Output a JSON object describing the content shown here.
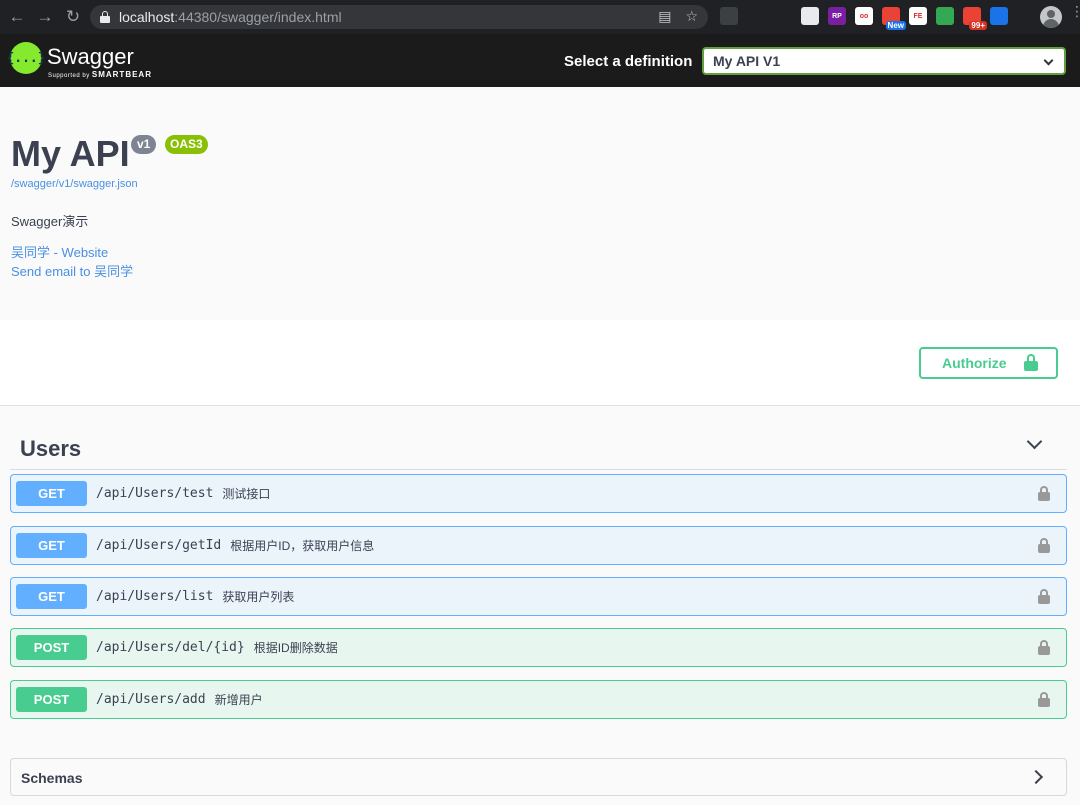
{
  "browser": {
    "url_host": "localhost",
    "url_rest": ":44380/swagger/index.html",
    "extensions": [
      {
        "name": "ext-1",
        "color": "#3c4043",
        "label": "",
        "badge": ""
      },
      {
        "name": "ext-2",
        "color": "#202124",
        "label": "",
        "badge": ""
      },
      {
        "name": "ext-3",
        "color": "#202124",
        "label": "",
        "badge": ""
      },
      {
        "name": "ext-4",
        "color": "#e8eaed",
        "label": "",
        "badge": ""
      },
      {
        "name": "ext-5",
        "color": "#7b1fa2",
        "label": "RP",
        "badge": ""
      },
      {
        "name": "ext-6",
        "color": "#ffffff",
        "label": "oo",
        "badge": ""
      },
      {
        "name": "ext-7",
        "color": "#ea4335",
        "label": "",
        "badge": "New"
      },
      {
        "name": "ext-8",
        "color": "#ffffff",
        "label": "FE",
        "badge": ""
      },
      {
        "name": "ext-9",
        "color": "#34a853",
        "label": "",
        "badge": ""
      },
      {
        "name": "ext-10",
        "color": "#ea4335",
        "label": "",
        "badge": "99+"
      },
      {
        "name": "ext-11",
        "color": "#1a73e8",
        "label": "",
        "badge": ""
      }
    ]
  },
  "topbar": {
    "logo_text": "Swagger",
    "logo_glyph": "{...}",
    "logo_sub_prefix": "Supported by",
    "logo_sub_brand": "SMARTBEAR",
    "definition_label": "Select a definition",
    "definition_value": "My API V1",
    "accent_color": "#85ea2d"
  },
  "info": {
    "title": "My API",
    "version": "v1",
    "oas_badge": "OAS3",
    "spec_url": "/swagger/v1/swagger.json",
    "description": "Swagger演示",
    "contact_website": "吴同学 - Website",
    "contact_email": "Send email to 吴同学"
  },
  "auth": {
    "label": "Authorize"
  },
  "tag": {
    "name": "Users",
    "operations": [
      {
        "method": "GET",
        "path": "/api/Users/test",
        "summary": "测试接口"
      },
      {
        "method": "GET",
        "path": "/api/Users/getId",
        "summary": "根据用户ID，获取用户信息"
      },
      {
        "method": "GET",
        "path": "/api/Users/list",
        "summary": "获取用户列表"
      },
      {
        "method": "POST",
        "path": "/api/Users/del/{id}",
        "summary": "根据ID删除数据"
      },
      {
        "method": "POST",
        "path": "/api/Users/add",
        "summary": "新增用户"
      }
    ]
  },
  "schemas": {
    "label": "Schemas"
  },
  "colors": {
    "get": "#61affe",
    "post": "#49cc90",
    "link": "#4990e2"
  }
}
